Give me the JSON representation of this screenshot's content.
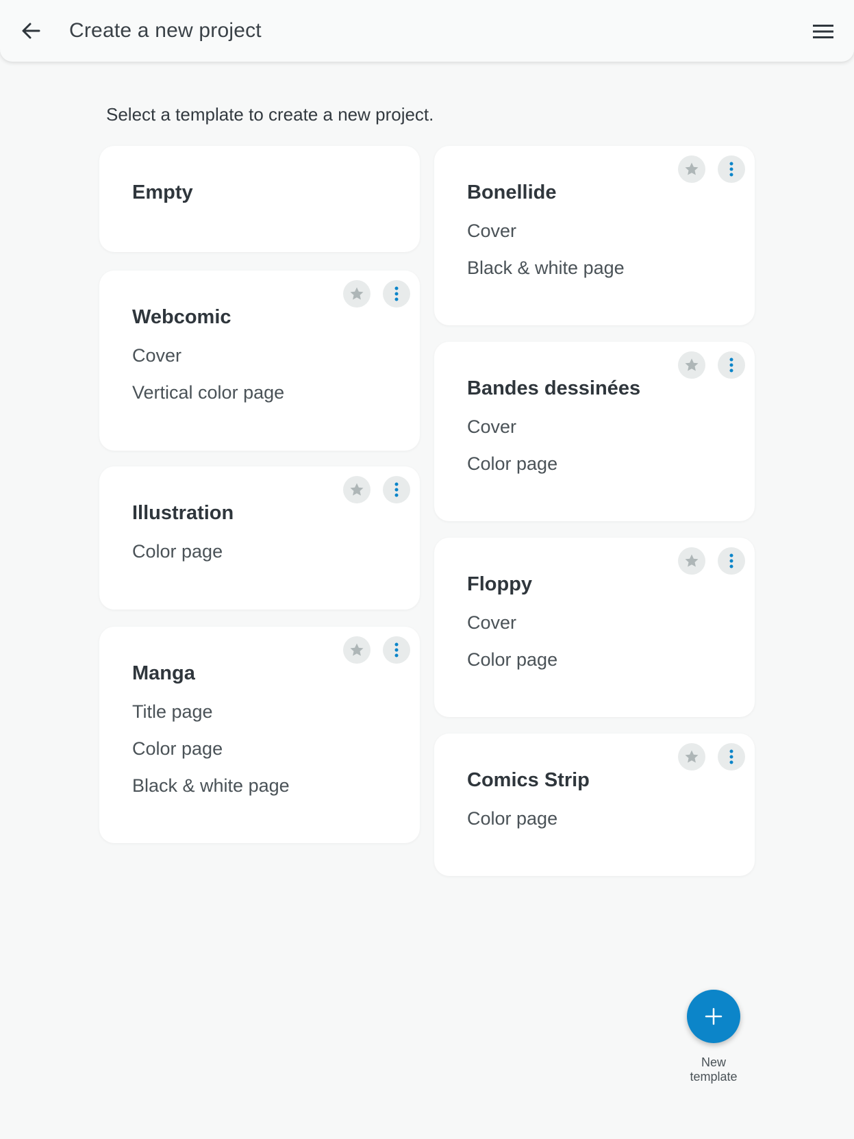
{
  "header": {
    "title": "Create a new project",
    "back_icon": "arrow-left-icon",
    "menu_icon": "hamburger-menu-icon"
  },
  "subtitle": "Select a template to create a new project.",
  "templates": [
    {
      "name": "Empty",
      "pages": []
    },
    {
      "name": "Bonellide",
      "pages": [
        "Cover",
        "Black & white page"
      ]
    },
    {
      "name": "Webcomic",
      "pages": [
        "Cover",
        "Vertical color page"
      ]
    },
    {
      "name": "Bandes dessinées",
      "pages": [
        "Cover",
        "Color page"
      ]
    },
    {
      "name": "Illustration",
      "pages": [
        "Color page"
      ]
    },
    {
      "name": "Floppy",
      "pages": [
        "Cover",
        "Color page"
      ]
    },
    {
      "name": "Manga",
      "pages": [
        "Title page",
        "Color page",
        "Black & white page"
      ]
    },
    {
      "name": "Comics Strip",
      "pages": [
        "Color page"
      ]
    }
  ],
  "fab": {
    "label_line1": "New",
    "label_line2": "template",
    "icon": "plus-icon"
  },
  "colors": {
    "accent": "#0c85c9",
    "background": "#f7f8f8",
    "card": "#ffffff",
    "star": "#aeb6b7"
  }
}
